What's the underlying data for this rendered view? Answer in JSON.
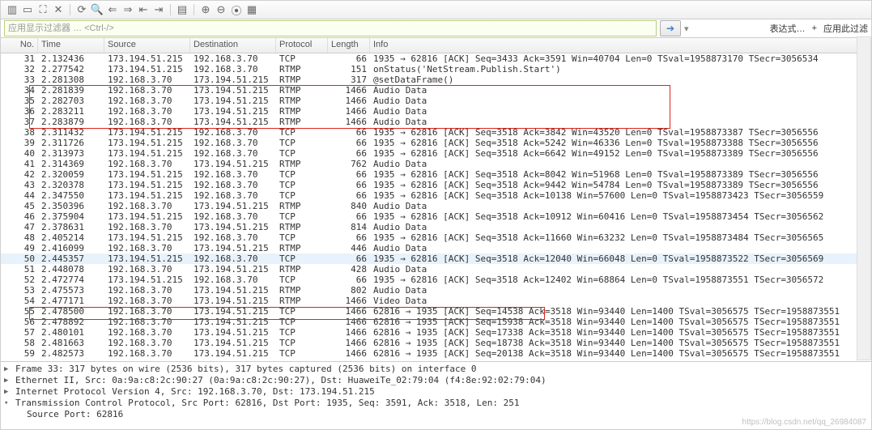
{
  "toolbar": {
    "icons": [
      "file-icon",
      "floppy-icon",
      "close-icon",
      "reload-icon",
      "magnifier-icon",
      "back-icon",
      "forward-icon",
      "step-icon",
      "goto-icon",
      "autoscroll-icon",
      "zoom-in-icon",
      "zoom-out-icon",
      "zoom-reset-icon",
      "resize-icon",
      "color-icon"
    ]
  },
  "filter": {
    "placeholder": "应用显示过滤器 … <Ctrl-/>",
    "expr_label": "表达式…",
    "add_btn": "+",
    "apply_filter": "应用此过滤"
  },
  "headers": {
    "no": "No.",
    "time": "Time",
    "src": "Source",
    "dst": "Destination",
    "proto": "Protocol",
    "len": "Length",
    "info": "Info"
  },
  "rows": [
    {
      "no": "31",
      "time": "2.132436",
      "src": "173.194.51.215",
      "dst": "192.168.3.70",
      "proto": "TCP",
      "len": "66",
      "info": "1935 → 62816 [ACK] Seq=3433 Ack=3591 Win=40704 Len=0 TSval=1958873170 TSecr=3056534",
      "hl": false
    },
    {
      "no": "32",
      "time": "2.277542",
      "src": "173.194.51.215",
      "dst": "192.168.3.70",
      "proto": "RTMP",
      "len": "151",
      "info": "onStatus('NetStream.Publish.Start')",
      "hl": false
    },
    {
      "no": "33",
      "time": "2.281308",
      "src": "192.168.3.70",
      "dst": "173.194.51.215",
      "proto": "RTMP",
      "len": "317",
      "info": "@setDataFrame()",
      "hl": false
    },
    {
      "no": "34",
      "time": "2.281839",
      "src": "192.168.3.70",
      "dst": "173.194.51.215",
      "proto": "RTMP",
      "len": "1466",
      "info": "Audio Data",
      "hl": false
    },
    {
      "no": "35",
      "time": "2.282703",
      "src": "192.168.3.70",
      "dst": "173.194.51.215",
      "proto": "RTMP",
      "len": "1466",
      "info": "Audio Data",
      "hl": false
    },
    {
      "no": "36",
      "time": "2.283211",
      "src": "192.168.3.70",
      "dst": "173.194.51.215",
      "proto": "RTMP",
      "len": "1466",
      "info": "Audio Data",
      "hl": false
    },
    {
      "no": "37",
      "time": "2.283879",
      "src": "192.168.3.70",
      "dst": "173.194.51.215",
      "proto": "RTMP",
      "len": "1466",
      "info": "Audio Data",
      "hl": false
    },
    {
      "no": "38",
      "time": "2.311432",
      "src": "173.194.51.215",
      "dst": "192.168.3.70",
      "proto": "TCP",
      "len": "66",
      "info": "1935 → 62816 [ACK] Seq=3518 Ack=3842 Win=43520 Len=0 TSval=1958873387 TSecr=3056556",
      "hl": false
    },
    {
      "no": "39",
      "time": "2.311726",
      "src": "173.194.51.215",
      "dst": "192.168.3.70",
      "proto": "TCP",
      "len": "66",
      "info": "1935 → 62816 [ACK] Seq=3518 Ack=5242 Win=46336 Len=0 TSval=1958873388 TSecr=3056556",
      "hl": false
    },
    {
      "no": "40",
      "time": "2.313973",
      "src": "173.194.51.215",
      "dst": "192.168.3.70",
      "proto": "TCP",
      "len": "66",
      "info": "1935 → 62816 [ACK] Seq=3518 Ack=6642 Win=49152 Len=0 TSval=1958873389 TSecr=3056556",
      "hl": false
    },
    {
      "no": "41",
      "time": "2.314369",
      "src": "192.168.3.70",
      "dst": "173.194.51.215",
      "proto": "RTMP",
      "len": "762",
      "info": "Audio Data",
      "hl": false
    },
    {
      "no": "42",
      "time": "2.320059",
      "src": "173.194.51.215",
      "dst": "192.168.3.70",
      "proto": "TCP",
      "len": "66",
      "info": "1935 → 62816 [ACK] Seq=3518 Ack=8042 Win=51968 Len=0 TSval=1958873389 TSecr=3056556",
      "hl": false
    },
    {
      "no": "43",
      "time": "2.320378",
      "src": "173.194.51.215",
      "dst": "192.168.3.70",
      "proto": "TCP",
      "len": "66",
      "info": "1935 → 62816 [ACK] Seq=3518 Ack=9442 Win=54784 Len=0 TSval=1958873389 TSecr=3056556",
      "hl": false
    },
    {
      "no": "44",
      "time": "2.347550",
      "src": "173.194.51.215",
      "dst": "192.168.3.70",
      "proto": "TCP",
      "len": "66",
      "info": "1935 → 62816 [ACK] Seq=3518 Ack=10138 Win=57600 Len=0 TSval=1958873423 TSecr=3056559",
      "hl": false
    },
    {
      "no": "45",
      "time": "2.350396",
      "src": "192.168.3.70",
      "dst": "173.194.51.215",
      "proto": "RTMP",
      "len": "840",
      "info": "Audio Data",
      "hl": false
    },
    {
      "no": "46",
      "time": "2.375904",
      "src": "173.194.51.215",
      "dst": "192.168.3.70",
      "proto": "TCP",
      "len": "66",
      "info": "1935 → 62816 [ACK] Seq=3518 Ack=10912 Win=60416 Len=0 TSval=1958873454 TSecr=3056562",
      "hl": false
    },
    {
      "no": "47",
      "time": "2.378631",
      "src": "192.168.3.70",
      "dst": "173.194.51.215",
      "proto": "RTMP",
      "len": "814",
      "info": "Audio Data",
      "hl": false
    },
    {
      "no": "48",
      "time": "2.405214",
      "src": "173.194.51.215",
      "dst": "192.168.3.70",
      "proto": "TCP",
      "len": "66",
      "info": "1935 → 62816 [ACK] Seq=3518 Ack=11660 Win=63232 Len=0 TSval=1958873484 TSecr=3056565",
      "hl": false
    },
    {
      "no": "49",
      "time": "2.416099",
      "src": "192.168.3.70",
      "dst": "173.194.51.215",
      "proto": "RTMP",
      "len": "446",
      "info": "Audio Data",
      "hl": false
    },
    {
      "no": "50",
      "time": "2.445357",
      "src": "173.194.51.215",
      "dst": "192.168.3.70",
      "proto": "TCP",
      "len": "66",
      "info": "1935 → 62816 [ACK] Seq=3518 Ack=12040 Win=66048 Len=0 TSval=1958873522 TSecr=3056569",
      "hl": true
    },
    {
      "no": "51",
      "time": "2.448078",
      "src": "192.168.3.70",
      "dst": "173.194.51.215",
      "proto": "RTMP",
      "len": "428",
      "info": "Audio Data",
      "hl": false
    },
    {
      "no": "52",
      "time": "2.472774",
      "src": "173.194.51.215",
      "dst": "192.168.3.70",
      "proto": "TCP",
      "len": "66",
      "info": "1935 → 62816 [ACK] Seq=3518 Ack=12402 Win=68864 Len=0 TSval=1958873551 TSecr=3056572",
      "hl": false
    },
    {
      "no": "53",
      "time": "2.475573",
      "src": "192.168.3.70",
      "dst": "173.194.51.215",
      "proto": "RTMP",
      "len": "802",
      "info": "Audio Data",
      "hl": false
    },
    {
      "no": "54",
      "time": "2.477171",
      "src": "192.168.3.70",
      "dst": "173.194.51.215",
      "proto": "RTMP",
      "len": "1466",
      "info": "Video Data",
      "hl": false
    },
    {
      "no": "55",
      "time": "2.478500",
      "src": "192.168.3.70",
      "dst": "173.194.51.215",
      "proto": "TCP",
      "len": "1466",
      "info": "62816 → 1935 [ACK] Seq=14538 Ack=3518 Win=93440 Len=1400 TSval=3056575 TSecr=1958873551",
      "hl": false
    },
    {
      "no": "56",
      "time": "2.478892",
      "src": "192.168.3.70",
      "dst": "173.194.51.215",
      "proto": "TCP",
      "len": "1466",
      "info": "62816 → 1935 [ACK] Seq=15938 Ack=3518 Win=93440 Len=1400 TSval=3056575 TSecr=1958873551",
      "hl": false
    },
    {
      "no": "57",
      "time": "2.480101",
      "src": "192.168.3.70",
      "dst": "173.194.51.215",
      "proto": "TCP",
      "len": "1466",
      "info": "62816 → 1935 [ACK] Seq=17338 Ack=3518 Win=93440 Len=1400 TSval=3056575 TSecr=1958873551",
      "hl": false
    },
    {
      "no": "58",
      "time": "2.481663",
      "src": "192.168.3.70",
      "dst": "173.194.51.215",
      "proto": "TCP",
      "len": "1466",
      "info": "62816 → 1935 [ACK] Seq=18738 Ack=3518 Win=93440 Len=1400 TSval=3056575 TSecr=1958873551",
      "hl": false
    },
    {
      "no": "59",
      "time": "2.482573",
      "src": "192.168.3.70",
      "dst": "173.194.51.215",
      "proto": "TCP",
      "len": "1466",
      "info": "62816 → 1935 [ACK] Seq=20138 Ack=3518 Win=93440 Len=1400 TSval=3056575 TSecr=1958873551",
      "hl": false
    }
  ],
  "details": {
    "frame": "Frame 33: 317 bytes on wire (2536 bits), 317 bytes captured (2536 bits) on interface 0",
    "eth": "Ethernet II, Src: 0a:9a:c8:2c:90:27 (0a:9a:c8:2c:90:27), Dst: HuaweiTe_02:79:04 (f4:8e:92:02:79:04)",
    "ip": "Internet Protocol Version 4, Src: 192.168.3.70, Dst: 173.194.51.215",
    "tcp": "Transmission Control Protocol, Src Port: 62816, Dst Port: 1935, Seq: 3591, Ack: 3518, Len: 251",
    "srcport": "Source Port: 62816"
  },
  "watermark": "https://blog.csdn.net/qq_26984087"
}
